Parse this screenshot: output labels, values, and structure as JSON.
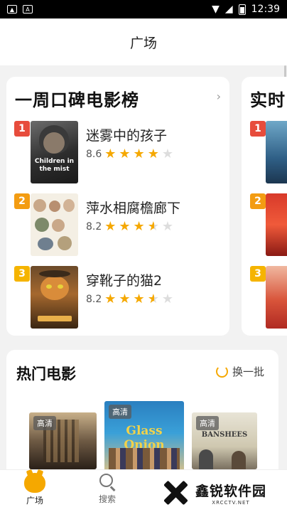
{
  "status_bar": {
    "time": "12:39"
  },
  "header": {
    "title": "广场"
  },
  "weekly_ranking": {
    "title": "一周口碑电影榜",
    "items": [
      {
        "rank": "1",
        "name": "迷雾中的孩子",
        "score": "8.6",
        "stars": 4,
        "poster_text": "Children in the mist"
      },
      {
        "rank": "2",
        "name": "萍水相腐檐廊下",
        "score": "8.2",
        "stars": 3.5
      },
      {
        "rank": "3",
        "name": "穿靴子的猫2",
        "score": "8.2",
        "stars": 3.5
      }
    ]
  },
  "realtime_ranking": {
    "title": "实时",
    "items": [
      {
        "rank": "1"
      },
      {
        "rank": "2"
      },
      {
        "rank": "3"
      }
    ]
  },
  "hot_movies": {
    "title": "热门电影",
    "refresh_label": "换一批",
    "items": [
      {
        "tag": "高清"
      },
      {
        "tag": "高清",
        "poster_title": "Glass Onion"
      },
      {
        "tag": "高清",
        "poster_title": "BANSHEES"
      }
    ]
  },
  "tabbar": {
    "tabs": [
      {
        "label": "广场",
        "icon": "plaza-icon",
        "active": true
      },
      {
        "label": "搜索",
        "icon": "search-icon",
        "active": false
      }
    ]
  },
  "watermark": {
    "name": "鑫锐软件园",
    "url": "XRCCTV.NET"
  },
  "colors": {
    "accent": "#f5a800",
    "rank1": "#e74c3c",
    "rank2": "#f39c12",
    "rank3": "#f5b400"
  }
}
